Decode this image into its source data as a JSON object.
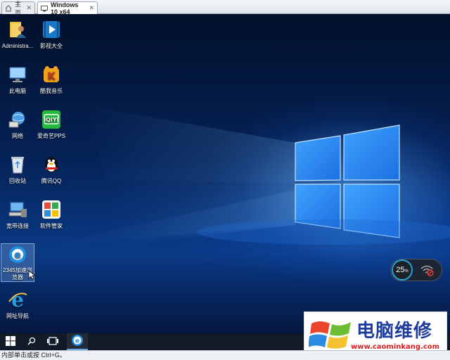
{
  "tabs": [
    {
      "label": "主页"
    },
    {
      "label": "Windows 10 x64"
    }
  ],
  "desktop_icons": [
    {
      "label": "Administra...",
      "icon": "user-folder-icon"
    },
    {
      "label": "影视大全",
      "icon": "video-player-icon"
    },
    {
      "label": "此电脑",
      "icon": "this-pc-icon"
    },
    {
      "label": "酷我音乐",
      "icon": "kuwo-music-icon"
    },
    {
      "label": "网络",
      "icon": "network-icon"
    },
    {
      "label": "爱奇艺PPS",
      "icon": "iqiyi-icon"
    },
    {
      "label": "回收站",
      "icon": "recycle-bin-icon"
    },
    {
      "label": "腾讯QQ",
      "icon": "qq-penguin-icon"
    },
    {
      "label": "宽带连接",
      "icon": "broadband-icon"
    },
    {
      "label": "软件管家",
      "icon": "software-manager-icon"
    },
    {
      "label": "2345加速浏览器",
      "icon": "browser-2345-icon"
    },
    {
      "label": "网址导航",
      "icon": "ie-icon"
    }
  ],
  "widget": {
    "percent": "25",
    "unit": "%"
  },
  "taskbar": {
    "icons": [
      "windows-start-icon",
      "search-icon",
      "task-view-icon",
      "browser-icon"
    ]
  },
  "watermark": {
    "title": "电脑维修",
    "url": "www.caominkang.com"
  },
  "status": {
    "text": "内部单击或按 Ctrl+G。"
  },
  "colors": {
    "accent": "#2aa2d8",
    "taskbar": "#08101e",
    "watermark_title": "#1e3c9c",
    "watermark_url": "#d42020"
  }
}
